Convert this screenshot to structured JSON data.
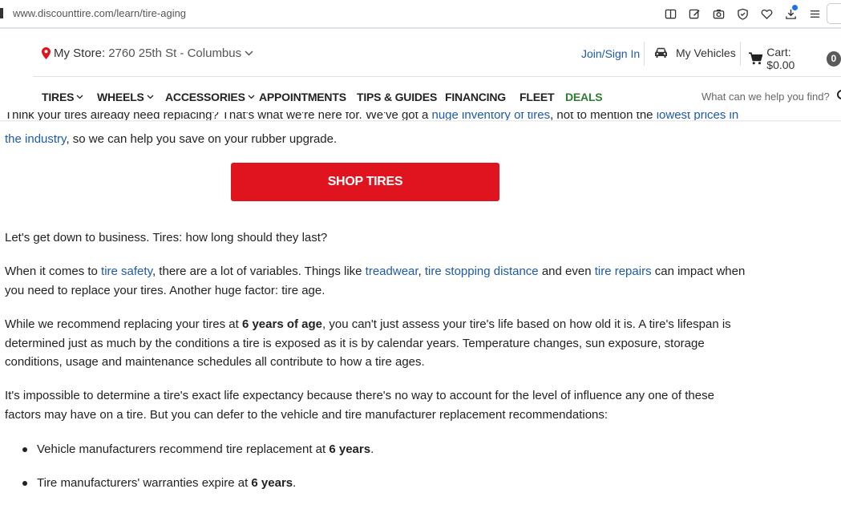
{
  "browser": {
    "url": "www.discounttire.com/learn/tire-aging",
    "tool_icons": [
      "reader-view-icon",
      "edit-icon",
      "screenshot-icon",
      "shield-icon",
      "favorite-icon",
      "download-icon",
      "menu-icon"
    ]
  },
  "header": {
    "store_label": "My Store:",
    "store_value": "2760 25th St - Columbus",
    "signin": "Join/Sign In",
    "vehicles": "My Vehicles",
    "cart": "Cart: $0.00",
    "cart_count": "0"
  },
  "nav": {
    "items": [
      {
        "label": "TIRES",
        "dropdown": true
      },
      {
        "label": "WHEELS",
        "dropdown": true
      },
      {
        "label": "ACCESSORIES",
        "dropdown": true
      },
      {
        "label": "APPOINTMENTS",
        "dropdown": false
      },
      {
        "label": "TIPS & GUIDES",
        "dropdown": false
      },
      {
        "label": "FINANCING",
        "dropdown": false
      },
      {
        "label": "FLEET",
        "dropdown": false
      },
      {
        "label": "DEALS",
        "dropdown": false
      }
    ],
    "search_placeholder": "What can we help you find?"
  },
  "content": {
    "intro_cut": {
      "t1": "Think your tires already need replacing? That's what we're here for. We've got a ",
      "l1": "huge inventory of tires",
      "t2": ", not to mention the ",
      "l2": "lowest prices in"
    },
    "intro_line2": {
      "l1": "the industry",
      "t1": ", so we can help you save on your rubber upgrade."
    },
    "shop_button": "SHOP TIRES",
    "p1": "Let's get down to business. Tires: how long should they last?",
    "p2": {
      "t1": "When it comes to ",
      "l1": "tire safety",
      "t2": ", there are a lot of variables. Things like ",
      "l2": "treadwear",
      "t3": ", ",
      "l3": "tire stopping distance",
      "t4": " and even ",
      "l4": "tire repairs",
      "t5": " can impact when you need to replace your tires. Another huge factor: tire age."
    },
    "p3": {
      "t1": "While we recommend replacing your tires at ",
      "b1": "6 years of age",
      "t2": ", you can't just assess your tire's life based on how old it is. A tire's lifespan is determined just as much by the conditions a tire is exposed as it is by calendar years. Temperature changes, sun exposure, storage conditions, usage and maintenance schedules all contribute to how a tire ages."
    },
    "p4": "It's impossible to determine a tire's exact life expectancy because there's no way to account for the level of influence any one of these factors may have on a tire. But you can defer to the vehicle and tire manufacturer replacement recommendations:",
    "bullets": [
      {
        "t": "Vehicle manufacturers recommend tire replacement at ",
        "b": "6 years",
        "end": "."
      },
      {
        "t": "Tire manufacturers' warranties expire at ",
        "b": "6 years",
        "end": "."
      }
    ]
  },
  "colors": {
    "link": "#1f5aa6",
    "cta": "#e0141e",
    "deals": "#2e7d32",
    "pin": "#e0141e"
  }
}
